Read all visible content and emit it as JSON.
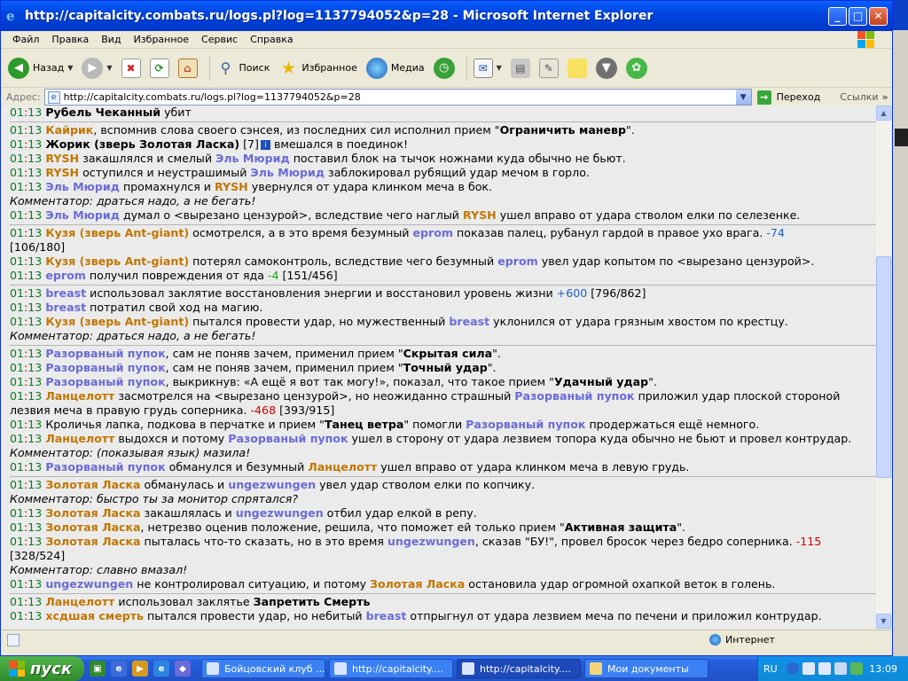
{
  "window": {
    "title": "http://capitalcity.combats.ru/logs.pl?log=1137794052&p=28 - Microsoft Internet Explorer",
    "min_icon": "minimize-icon",
    "max_icon": "maximize-icon",
    "close_icon": "close-icon"
  },
  "menu": [
    "Файл",
    "Правка",
    "Вид",
    "Избранное",
    "Сервис",
    "Справка"
  ],
  "toolbar": {
    "back": "Назад",
    "search": "Поиск",
    "favorites": "Избранное",
    "media": "Медиа"
  },
  "address": {
    "label": "Адрес:",
    "url": "http://capitalcity.combats.ru/logs.pl?log=1137794052&p=28",
    "go": "Переход",
    "links": "Ссылки"
  },
  "log": {
    "l1": {
      "t1": "01",
      "t2": "13",
      "name": "Рубель Чеканный",
      "rest": " убит"
    },
    "l2": {
      "t1": "01",
      "t2": "13",
      "name": "Кайрик",
      "mid": ", вспомнив слова своего сэнсея, из последних сил исполнил прием \"",
      "move": "Ограничить маневр",
      "end": "\"."
    },
    "l3": {
      "t1": "01",
      "t2": "13",
      "name": "Жорик (зверь Золотая Ласка)",
      "mid": " [7]",
      "end": " вмешался в поединок!"
    },
    "l4": {
      "t1": "01",
      "t2": "13",
      "a": "RYSH",
      "mid": " закашлялся и смелый ",
      "b": "Эль Мюрид",
      "end": " поставил блок на тычок ножнами куда обычно не бьют."
    },
    "l5": {
      "t1": "01",
      "t2": "13",
      "a": "RYSH",
      "mid": " оступился и неустрашимый ",
      "b": "Эль Мюрид",
      "end": " заблокировал рубящий удар мечом в горло."
    },
    "l6": {
      "t1": "01",
      "t2": "13",
      "a": "Эль Мюрид",
      "mid": " промахнулся и ",
      "b": "RYSH",
      "end": " увернулся от удара клинком меча в бок."
    },
    "c1": "Комментатор: драться надо, а не бегать!",
    "l7": {
      "t1": "01",
      "t2": "13",
      "a": "Эль Мюрид",
      "mid": " думал о <вырезано цензурой>, вследствие чего наглый ",
      "b": "RYSH",
      "end": " ушел вправо от удара стволом елки по селезенке."
    },
    "l8": {
      "t1": "01",
      "t2": "13",
      "a": "Кузя (зверь Ant-giant)",
      "mid": " осмотрелся, а в это время безумный ",
      "b": "eprom",
      "end": " показав палец, рубанул гардой в правое ухо врага. ",
      "dmg": "-74",
      "hp": "[106/180]"
    },
    "l9": {
      "t1": "01",
      "t2": "13",
      "a": "Кузя (зверь Ant-giant)",
      "mid": " потерял самоконтроль, вследствие чего безумный ",
      "b": "eprom",
      "end": " увел удар копытом по <вырезано цензурой>."
    },
    "l10": {
      "t1": "01",
      "t2": "13",
      "a": "eprom",
      "mid": " получил повреждения от яда ",
      "dmg": "-4",
      "hp": " [151/456]"
    },
    "l11": {
      "t1": "01",
      "t2": "13",
      "a": "breast",
      "mid": " использовал заклятие восстановления энергии и восстановил уровень жизни ",
      "heal": "+600",
      "hp": " [796/862]"
    },
    "l12": {
      "t1": "01",
      "t2": "13",
      "a": "breast",
      "end": " потратил свой ход на магию."
    },
    "l13": {
      "t1": "01",
      "t2": "13",
      "a": "Кузя (зверь Ant-giant)",
      "mid": " пытался провести удар, но мужественный ",
      "b": "breast",
      "end": " уклонился от удара грязным хвостом по крестцу."
    },
    "c2": "Комментатор: драться надо, а не бегать!",
    "l14": {
      "t1": "01",
      "t2": "13",
      "a": "Разорваный пупок",
      "mid": ", сам не поняв зачем, применил прием \"",
      "move": "Скрытая сила",
      "end": "\"."
    },
    "l15": {
      "t1": "01",
      "t2": "13",
      "a": "Разорваный пупок",
      "mid": ", сам не поняв зачем, применил прием \"",
      "move": "Точный удар",
      "end": "\"."
    },
    "l16": {
      "t1": "01",
      "t2": "13",
      "a": "Разорваный пупок",
      "mid": ", выкрикнув: «А ещё я вот так могу!», показал, что такое прием \"",
      "move": "Удачный удар",
      "end": "\"."
    },
    "l17": {
      "t1": "01",
      "t2": "13",
      "a": "Ланцелотт",
      "mid": " засмотрелся на <вырезано цензурой>, но неожиданно страшный ",
      "b": "Разорваный пупок",
      "end": " приложил удар плоской стороной лезвия меча в правую грудь соперника. ",
      "dmg": "-468",
      "hp": " [393/915]"
    },
    "l18": {
      "t1": "01",
      "t2": "13",
      "pre": " Кроличья лапка, подкова в перчатке и прием \"",
      "move": "Танец ветра",
      "mid": "\" помогли ",
      "b": "Разорваный пупок",
      "end": " продержаться ещё немного."
    },
    "l19": {
      "t1": "01",
      "t2": "13",
      "a": "Ланцелотт",
      "mid": " выдохся и потому ",
      "b": "Разорваный пупок",
      "end": " ушел в сторону от удара лезвием топора куда обычно не бьют и провел контрудар."
    },
    "c3": "Комментатор: (показывая язык) мазила!",
    "l20": {
      "t1": "01",
      "t2": "13",
      "a": "Разорваный пупок",
      "mid": " обманулся и безумный ",
      "b": "Ланцелотт",
      "end": " ушел вправо от удара клинком меча в левую грудь."
    },
    "l21": {
      "t1": "01",
      "t2": "13",
      "a": "Золотая Ласка",
      "mid": " обманулась и ",
      "b": "ungezwungen",
      "end": " увел удар стволом елки по копчику."
    },
    "c4": "Комментатор: быстро ты за монитор спрятался?",
    "l22": {
      "t1": "01",
      "t2": "13",
      "a": "Золотая Ласка",
      "mid": " закашлялась и ",
      "b": "ungezwungen",
      "end": " отбил удар елкой в репу."
    },
    "l23": {
      "t1": "01",
      "t2": "13",
      "a": "Золотая Ласка",
      "mid": ", нетрезво оценив положение, решила, что поможет ей только прием \"",
      "move": "Активная защита",
      "end": "\"."
    },
    "l24": {
      "t1": "01",
      "t2": "13",
      "a": "Золотая Ласка",
      "mid": " пыталась что-то сказать, но в это время ",
      "b": "ungezwungen",
      "end": ", сказав \"БУ!\", провел бросок через бедро соперника. ",
      "dmg": "-115",
      "hp": "[328/524]"
    },
    "c5": "Комментатор: славно вмазал!",
    "l25": {
      "t1": "01",
      "t2": "13",
      "a": "ungezwungen",
      "mid": " не контролировал ситуацию, и потому ",
      "b": "Золотая Ласка",
      "end": " остановила удар огромной охапкой веток в голень."
    },
    "l26": {
      "t1": "01",
      "t2": "13",
      "a": "Ланцелотт",
      "mid": " использовал заклятье ",
      "move": "Запретить Смерть"
    },
    "l27": {
      "t1": "01",
      "t2": "13",
      "a": "хсдшая смерть",
      "mid": " пытался провести удар, но небитый ",
      "b": "breast",
      "end": " отпрыгнул от удара лезвием меча по печени и приложил контрудар."
    }
  },
  "status": {
    "zone": "Интернет"
  },
  "taskbar": {
    "start": "пуск",
    "tasks": [
      "Бойцовский клуб ...",
      "http://capitalcity....",
      "http://capitalcity....",
      "Мои документы"
    ],
    "lang": "RU",
    "clock": "13:09"
  }
}
